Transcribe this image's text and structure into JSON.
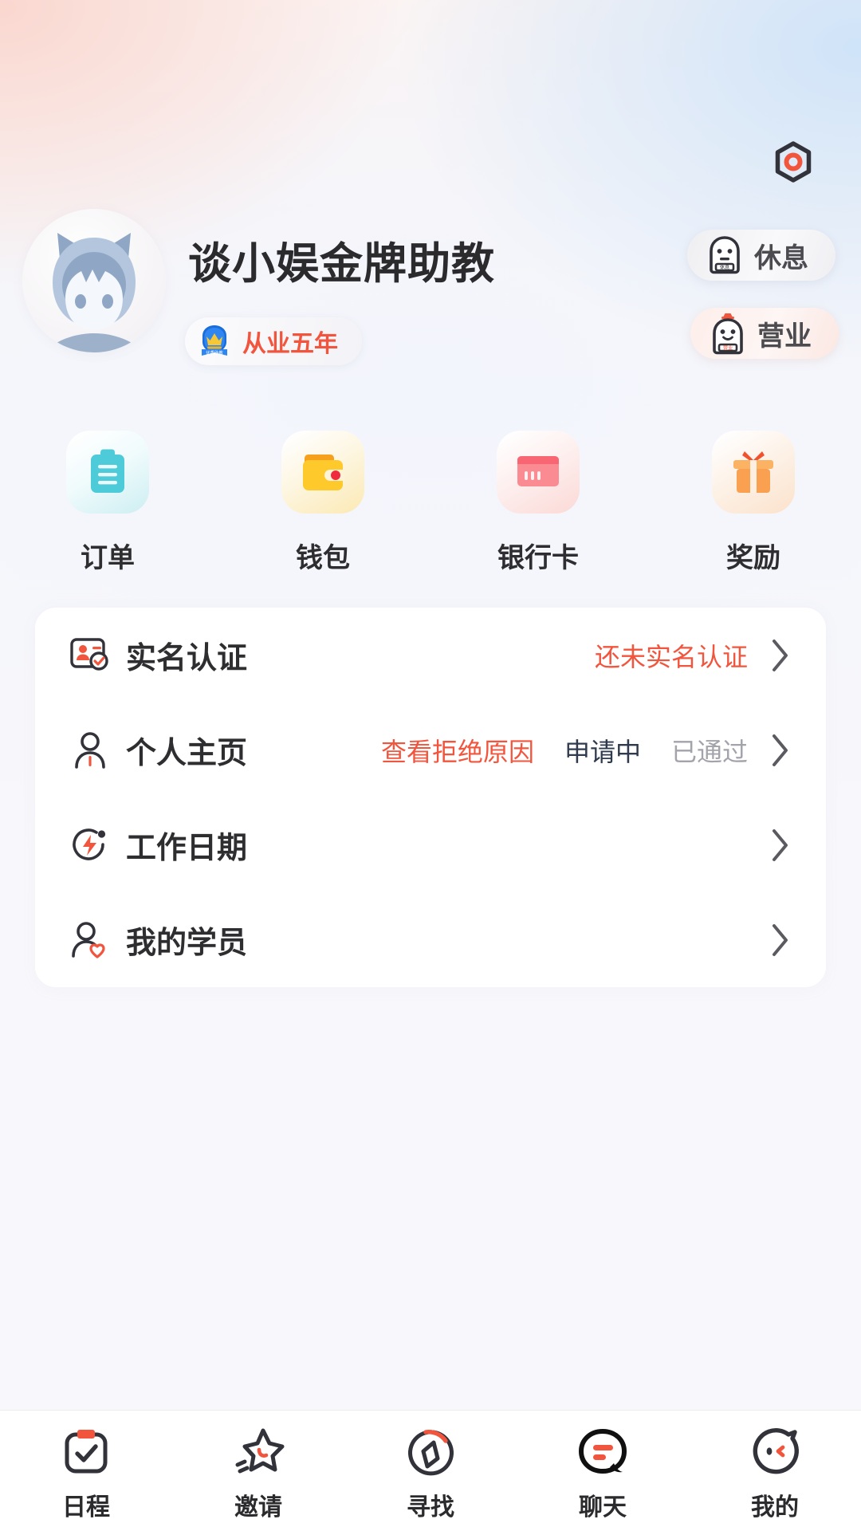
{
  "colors": {
    "accent_orange": "#f2553d",
    "accent_dark": "#2e2e31",
    "muted_gray": "#a3a3ab",
    "status_dark": "#2f3b4c",
    "card_white": "#ffffff",
    "bg_pink": "#fad6ce",
    "bg_blue": "#cde3f9",
    "bg_base": "#f8f8fc",
    "avatar_blue": "#9fb4d0",
    "orders_cyan": "#4ecbd8",
    "wallet_yellow": "#fdc92b",
    "card_pink": "#fb7a83",
    "reward_orange": "#f9a150"
  },
  "header": {
    "settings_icon": "hexagon-settings-icon",
    "avatar_icon": "cat-hood-avatar",
    "display_name": "谈小娱金牌助教",
    "tenure_badge": {
      "icon": "crown-medal-icon",
      "label": "从业五年"
    },
    "status_pills": [
      {
        "icon": "robot-rest-icon",
        "label": "休息",
        "state": "inactive"
      },
      {
        "icon": "robot-open-icon",
        "label": "营业",
        "state": "active"
      }
    ]
  },
  "quick_actions": [
    {
      "icon": "clipboard-icon",
      "label": "订单",
      "tile_class": "tile-orders"
    },
    {
      "icon": "wallet-icon",
      "label": "钱包",
      "tile_class": "tile-wallet"
    },
    {
      "icon": "bank-card-icon",
      "label": "银行卡",
      "tile_class": "tile-card"
    },
    {
      "icon": "gift-icon",
      "label": "奖励",
      "tile_class": "tile-reward"
    }
  ],
  "menu_rows": [
    {
      "icon": "id-card-verify-icon",
      "label": "实名认证",
      "statuses": [
        {
          "text": "还未实名认证",
          "style": "st-danger"
        }
      ]
    },
    {
      "icon": "person-icon",
      "label": "个人主页",
      "statuses": [
        {
          "text": "查看拒绝原因",
          "style": "st-danger"
        },
        {
          "text": "申请中",
          "style": "st-dark"
        },
        {
          "text": "已通过",
          "style": "st-muted"
        }
      ]
    },
    {
      "icon": "lightning-clock-icon",
      "label": "工作日期",
      "statuses": []
    },
    {
      "icon": "person-heart-icon",
      "label": "我的学员",
      "statuses": []
    }
  ],
  "tabbar": [
    {
      "icon": "calendar-check-icon",
      "label": "日程",
      "active": false
    },
    {
      "icon": "star-sparkle-icon",
      "label": "邀请",
      "active": false
    },
    {
      "icon": "compass-icon",
      "label": "寻找",
      "active": false
    },
    {
      "icon": "chat-bubble-icon",
      "label": "聊天",
      "active": false
    },
    {
      "icon": "face-profile-icon",
      "label": "我的",
      "active": true
    }
  ]
}
